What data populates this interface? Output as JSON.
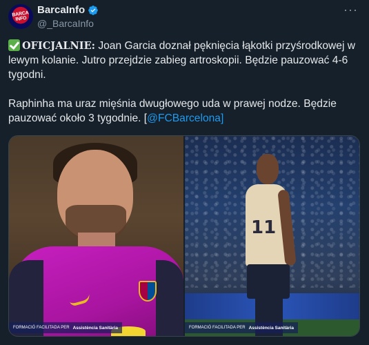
{
  "author": {
    "display_name": "BarcaInfo",
    "handle": "@_BarcaInfo",
    "avatar_text": "BARCA INFO",
    "verified_icon": "verified-badge-icon"
  },
  "more_label": "···",
  "tweet": {
    "line1_emoji": "check-mark-icon",
    "line1_bold": "OFICJALNIE:",
    "line1_rest": " Joan Garcia doznał pęknięcia łąkotki przyśrodkowej w lewym kolanie. Jutro przejdzie zabieg artroskopii. Będzie pauzować 4-6 tygodni.",
    "line2_text": "Raphinha ma uraz mięśnia dwugłowego uda w prawej nodze. Będzie pauzować około 3 tygodnie. [",
    "line2_link": "@FCBarcelona",
    "line2_end": "]"
  },
  "media": {
    "left_caption_small": "FORMACIÓ FACILITADA PER",
    "left_caption_sponsor": "Assistència Sanitària",
    "right_caption_small": "FORMACIÓ FACILITADA PER",
    "right_caption_sponsor": "Assistència Sanitària",
    "shirt_number": "11"
  },
  "colors": {
    "background": "#15202b",
    "link": "#1d9bf0",
    "verified": "#1d9bf0",
    "check": "#5cb04a"
  }
}
